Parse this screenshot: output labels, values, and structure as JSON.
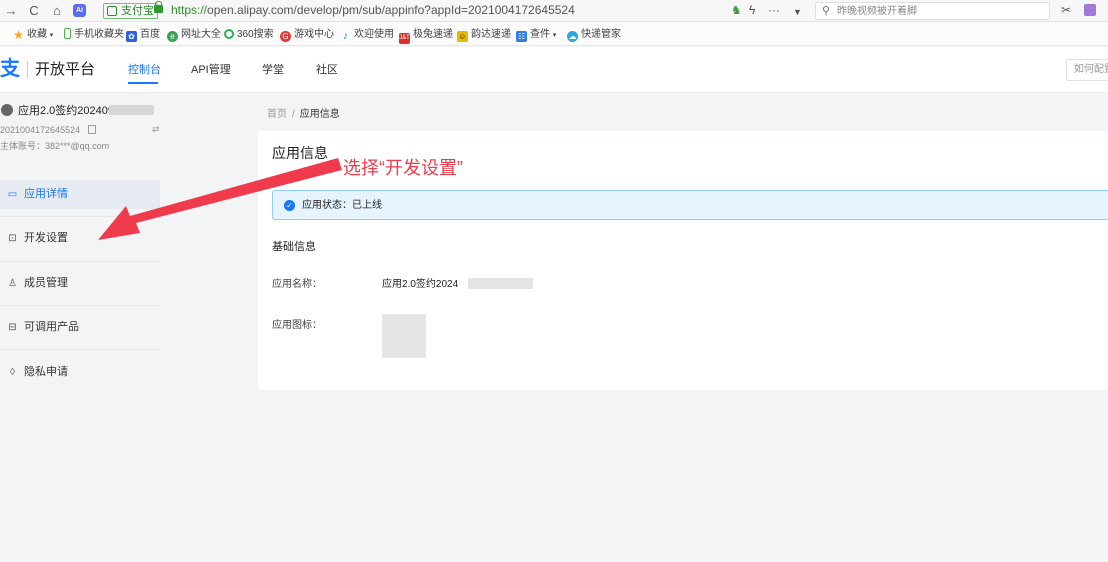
{
  "browser": {
    "back": "→",
    "reload": "C",
    "home": "⌂",
    "ai_badge": "Ai",
    "site_chip": "支付宝",
    "url_protocol": "https://",
    "url_rest": "open.alipay.com/develop/pm/sub/appinfo?appId=2021004172645524",
    "more": "···",
    "search_query": "昨晚视频被开着脚",
    "cut": "✂"
  },
  "bookmarks": [
    {
      "label": "收藏",
      "icon": "star-icon",
      "color": "#f5a623"
    },
    {
      "label": "手机收藏夹",
      "icon": "phone-icon",
      "color": "#4caf50"
    },
    {
      "label": "百度",
      "icon": "paw-icon",
      "color": "#2f5fd8"
    },
    {
      "label": "网址大全",
      "icon": "globe-icon",
      "color": "#3aa35a"
    },
    {
      "label": "360搜索",
      "icon": "search-360-icon",
      "color": "#2fb24b"
    },
    {
      "label": "游戏中心",
      "icon": "game-icon",
      "color": "#e03b3b"
    },
    {
      "label": "欢迎使用",
      "icon": "welcome-icon",
      "color": "#3d8be8"
    },
    {
      "label": "极兔速递",
      "icon": "jitu-icon",
      "color": "#d9302d"
    },
    {
      "label": "韵达速递",
      "icon": "yunda-icon",
      "color": "#e6b800"
    },
    {
      "label": "查件",
      "icon": "query-icon",
      "color": "#2f7ee0"
    },
    {
      "label": "快递管家",
      "icon": "express-icon",
      "color": "#2aa9e0"
    }
  ],
  "header": {
    "logo_mark": "支",
    "logo_text": "开放平台",
    "tabs": [
      "控制台",
      "API管理",
      "学堂",
      "社区"
    ],
    "help_placeholder": "如何配置"
  },
  "sidebar": {
    "app_name": "应用2.0签约202409",
    "app_id": "2021004172645524",
    "switch": "⇄",
    "account": "主体账号：382***@qq.com",
    "items": [
      {
        "label": "应用详情",
        "icon": "app-detail-icon",
        "glyph": "▭"
      },
      {
        "label": "开发设置",
        "icon": "dev-settings-icon",
        "glyph": "⊡"
      },
      {
        "label": "成员管理",
        "icon": "members-icon",
        "glyph": "♙"
      },
      {
        "label": "可调用产品",
        "icon": "products-icon",
        "glyph": "⊟"
      },
      {
        "label": "隐私申请",
        "icon": "privacy-shield-icon",
        "glyph": "◊"
      }
    ]
  },
  "breadcrumb": {
    "home": "首页",
    "sep": "/",
    "current": "应用信息"
  },
  "card": {
    "title": "应用信息",
    "status_icon": "✓",
    "status": "应用状态：已上线",
    "section": "基础信息",
    "name_label": "应用名称：",
    "name_value": "应用2.0签约2024",
    "icon_label": "应用图标："
  },
  "annotation": {
    "text": "选择“开发设置”",
    "color": "#ef3b4c"
  }
}
